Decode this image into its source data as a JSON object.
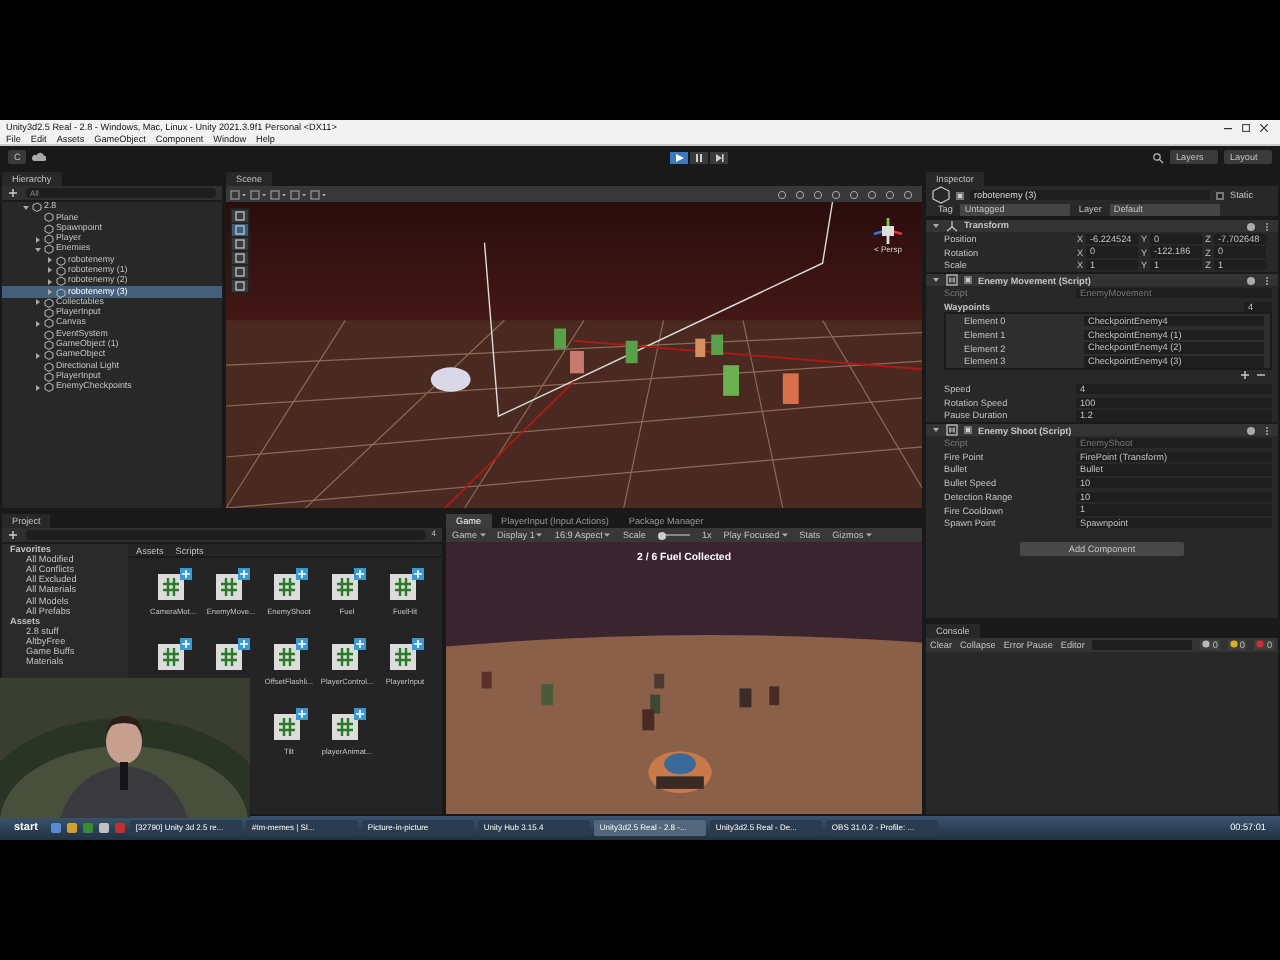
{
  "window": {
    "title": "Unity3d2.5 Real - 2.8 - Windows, Mac, Linux - Unity 2021.3.9f1 Personal <DX11>"
  },
  "menu": [
    "File",
    "Edit",
    "Assets",
    "GameObject",
    "Component",
    "Window",
    "Help"
  ],
  "toolbar": {
    "account": "C",
    "layers": "Layers",
    "layout": "Layout"
  },
  "hierarchy": {
    "title": "Hierarchy",
    "placeholder": "All",
    "items": [
      {
        "label": "2.8",
        "selected": false,
        "expanded": true,
        "children": [
          {
            "label": "Plane",
            "selected": false
          },
          {
            "label": "Spawnpoint",
            "selected": false
          },
          {
            "label": "Player",
            "selected": false,
            "expanded": false
          },
          {
            "label": "Enemies",
            "selected": false,
            "expanded": true,
            "children": [
              {
                "label": "robotenemy",
                "selected": false,
                "expanded": false
              },
              {
                "label": "robotenemy (1)",
                "selected": false,
                "expanded": false
              },
              {
                "label": "robotenemy (2)",
                "selected": false,
                "expanded": false
              },
              {
                "label": "robotenemy (3)",
                "selected": true,
                "expanded": false
              }
            ]
          },
          {
            "label": "Collectables",
            "selected": false,
            "expanded": false
          },
          {
            "label": "PlayerInput",
            "selected": false
          },
          {
            "label": "Canvas",
            "selected": false,
            "expanded": false
          },
          {
            "label": "EventSystem",
            "selected": false
          },
          {
            "label": "GameObject (1)",
            "selected": false
          },
          {
            "label": "GameObject",
            "selected": false,
            "expanded": false
          },
          {
            "label": "Directional Light",
            "selected": false
          },
          {
            "label": "PlayerInput",
            "selected": false
          },
          {
            "label": "EnemyCheckpoints",
            "selected": false,
            "expanded": false
          }
        ]
      }
    ]
  },
  "scene": {
    "tab": "Scene",
    "camera": "< Persp"
  },
  "project": {
    "title": "Project",
    "favorites_label": "Favorites",
    "favorites": [
      "All Modified",
      "All Conflicts",
      "All Excluded",
      "All Materials",
      "All Models",
      "All Prefabs"
    ],
    "assets_label": "Assets",
    "folders": [
      "2.8 stuff",
      "AltbyFree",
      "Game Buffs",
      "Materials"
    ],
    "breadcrumb": [
      "Assets",
      "Scripts"
    ],
    "count": "4",
    "files": [
      {
        "kind": "script",
        "label": "CameraMot..."
      },
      {
        "kind": "script",
        "label": "EnemyMove..."
      },
      {
        "kind": "script",
        "label": "EnemyShoot"
      },
      {
        "kind": "script",
        "label": "Fuel"
      },
      {
        "kind": "script",
        "label": "FuelHit"
      },
      {
        "kind": "script"
      },
      {
        "kind": "script"
      },
      {
        "kind": "script",
        "label": "OffsetFlashli..."
      },
      {
        "kind": "script",
        "label": "PlayerControl..."
      },
      {
        "kind": "script",
        "label": "PlayerInput"
      },
      {
        "kind": "script",
        "label": "Tilt"
      },
      {
        "kind": "script",
        "label": "playerAnimat..."
      }
    ]
  },
  "game": {
    "tabs": [
      {
        "label": "Game",
        "selected": true
      },
      {
        "label": "PlayerInput (Input Actions)",
        "selected": false
      },
      {
        "label": "Package Manager",
        "selected": false
      }
    ],
    "controls": [
      {
        "kind": "dropdown",
        "label": "Game"
      },
      {
        "kind": "dropdown",
        "label": "Display 1"
      },
      {
        "kind": "dropdown",
        "label": "16:9 Aspect"
      },
      {
        "kind": "slider",
        "label": "Scale",
        "level": 0.15,
        "reading": "1x"
      },
      {
        "kind": "dropdown",
        "label": "Play Focused"
      },
      {
        "kind": "button",
        "label": "Stats"
      },
      {
        "kind": "dropdown",
        "label": "Gizmos"
      }
    ],
    "hud": "2 / 6 Fuel Collected"
  },
  "inspector": {
    "title": "Inspector",
    "object": {
      "active": true,
      "name": "robotenemy (3)",
      "static": "Static",
      "static_checked": false,
      "tag_label": "Tag",
      "tag": "Untagged",
      "layer_label": "Layer",
      "layer": "Default"
    },
    "components": [
      {
        "kind": "transform",
        "title": "Transform",
        "expanded": true,
        "rows": [
          {
            "kind": "vector",
            "label": "Position",
            "cells": [
              {
                "axis": "X",
                "value": "-6.224524"
              },
              {
                "axis": "Y",
                "value": "0"
              },
              {
                "axis": "Z",
                "value": "-7.702648"
              }
            ]
          },
          {
            "kind": "vector",
            "label": "Rotation",
            "cells": [
              {
                "axis": "X",
                "value": "0"
              },
              {
                "axis": "Y",
                "value": "-122.186"
              },
              {
                "axis": "Z",
                "value": "0"
              }
            ]
          },
          {
            "kind": "vector",
            "label": "Scale",
            "cells": [
              {
                "axis": "X",
                "value": "1"
              },
              {
                "axis": "Y",
                "value": "1"
              },
              {
                "axis": "Z",
                "value": "1"
              }
            ]
          }
        ]
      },
      {
        "kind": "script",
        "title": "Enemy Movement (Script)",
        "enabled": true,
        "expanded": true,
        "rows": [
          {
            "kind": "script",
            "label": "Script",
            "value": "EnemyMovement"
          },
          {
            "kind": "list",
            "label": "Waypoints",
            "count": "4",
            "elements": [
              {
                "label": "Element 0",
                "value": "CheckpointEnemy4"
              },
              {
                "label": "Element 1",
                "value": "CheckpointEnemy4 (1)"
              },
              {
                "label": "Element 2",
                "value": "CheckpointEnemy4 (2)"
              },
              {
                "label": "Element 3",
                "value": "CheckpointEnemy4 (3)"
              }
            ]
          },
          {
            "kind": "field",
            "label": "Speed",
            "value": "4"
          },
          {
            "kind": "field",
            "label": "Rotation Speed",
            "value": "100"
          },
          {
            "kind": "field",
            "label": "Pause Duration",
            "value": "1.2"
          }
        ]
      },
      {
        "kind": "script",
        "title": "Enemy Shoot (Script)",
        "enabled": true,
        "expanded": true,
        "rows": [
          {
            "kind": "script",
            "label": "Script",
            "value": "EnemyShoot"
          },
          {
            "kind": "ref",
            "label": "Fire Point",
            "value": "FirePoint (Transform)"
          },
          {
            "kind": "ref",
            "label": "Bullet",
            "value": "Bullet"
          },
          {
            "kind": "field",
            "label": "Bullet Speed",
            "value": "10"
          },
          {
            "kind": "field",
            "label": "Detection Range",
            "value": "10"
          },
          {
            "kind": "field",
            "label": "Fire Cooldown",
            "value": "1"
          },
          {
            "kind": "ref",
            "label": "Spawn Point",
            "value": "Spawnpoint"
          }
        ]
      }
    ],
    "add_component": "Add Component"
  },
  "console": {
    "title": "Console",
    "buttons": [
      "Clear",
      "Collapse",
      "Error Pause",
      "Editor"
    ],
    "counts": [
      {
        "kind": "info",
        "value": "0"
      },
      {
        "kind": "warning",
        "value": "0"
      },
      {
        "kind": "error",
        "value": "0"
      }
    ]
  },
  "taskbar": {
    "start": "start",
    "tasks": [
      {
        "label": "[32790] Unity 3d 2.5 re...",
        "selected": false
      },
      {
        "label": "#tm-memes | Sl...",
        "selected": false
      },
      {
        "label": "Picture-in-picture",
        "selected": false
      },
      {
        "label": "Unity Hub 3.15.4",
        "selected": false
      },
      {
        "label": "Unity3d2.5 Real - 2.8 -...",
        "selected": true
      },
      {
        "label": "Unity3d2.5 Real - De...",
        "selected": false
      },
      {
        "label": "OBS 31.0.2 - Profile: ...",
        "selected": false
      }
    ],
    "clock": "00:57:01"
  }
}
